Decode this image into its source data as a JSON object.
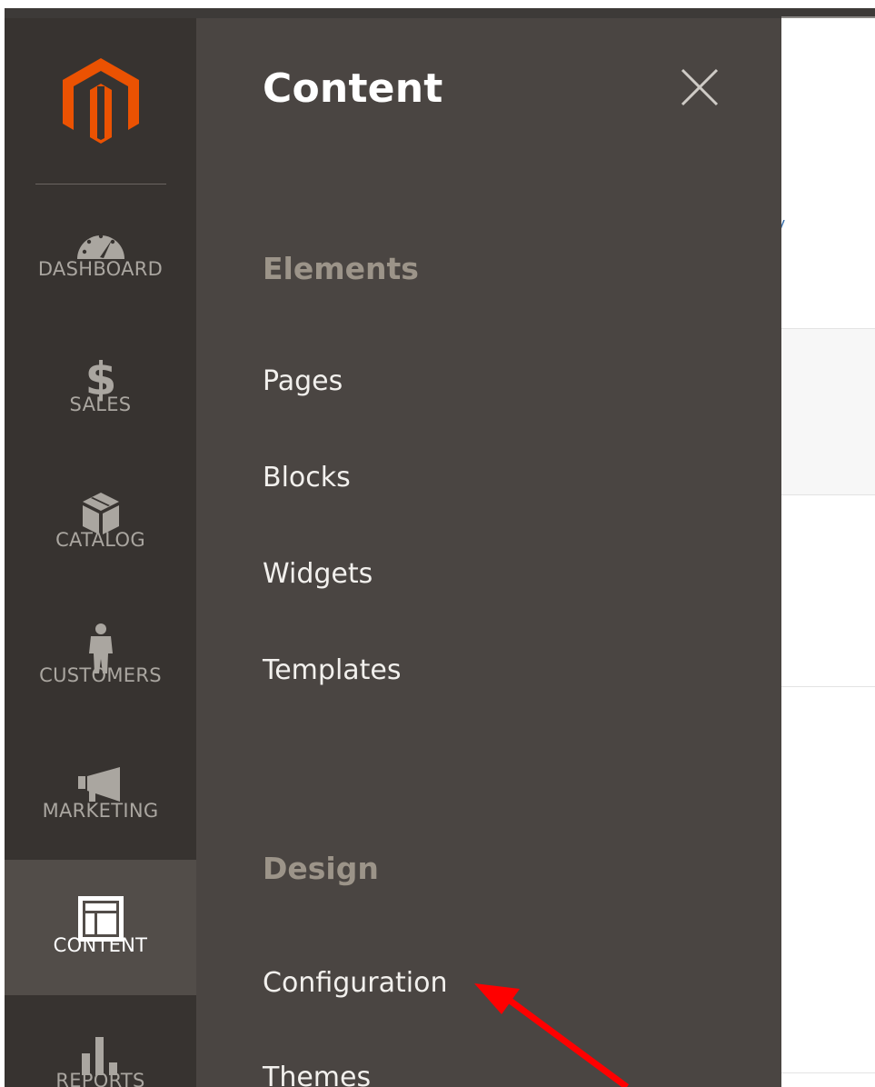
{
  "sidebar": {
    "items": [
      {
        "label": "DASHBOARD",
        "icon": "dashboard-gauge-icon"
      },
      {
        "label": "SALES",
        "icon": "dollar-icon"
      },
      {
        "label": "CATALOG",
        "icon": "box-icon"
      },
      {
        "label": "CUSTOMERS",
        "icon": "person-icon"
      },
      {
        "label": "MARKETING",
        "icon": "megaphone-icon"
      },
      {
        "label": "CONTENT",
        "icon": "layout-icon"
      },
      {
        "label": "REPORTS",
        "icon": "bar-chart-icon"
      }
    ],
    "active": "CONTENT"
  },
  "flyout": {
    "title": "Content",
    "sections": [
      {
        "title": "Elements",
        "items": [
          "Pages",
          "Blocks",
          "Widgets",
          "Templates"
        ]
      },
      {
        "title": "Design",
        "items": [
          "Configuration",
          "Themes"
        ]
      }
    ]
  },
  "colors": {
    "sidebar_bg": "#373330",
    "flyout_bg": "#4a4542",
    "active_item_bg": "#524d49",
    "logo_orange": "#eb5202",
    "annotation_arrow": "#ff0000"
  }
}
